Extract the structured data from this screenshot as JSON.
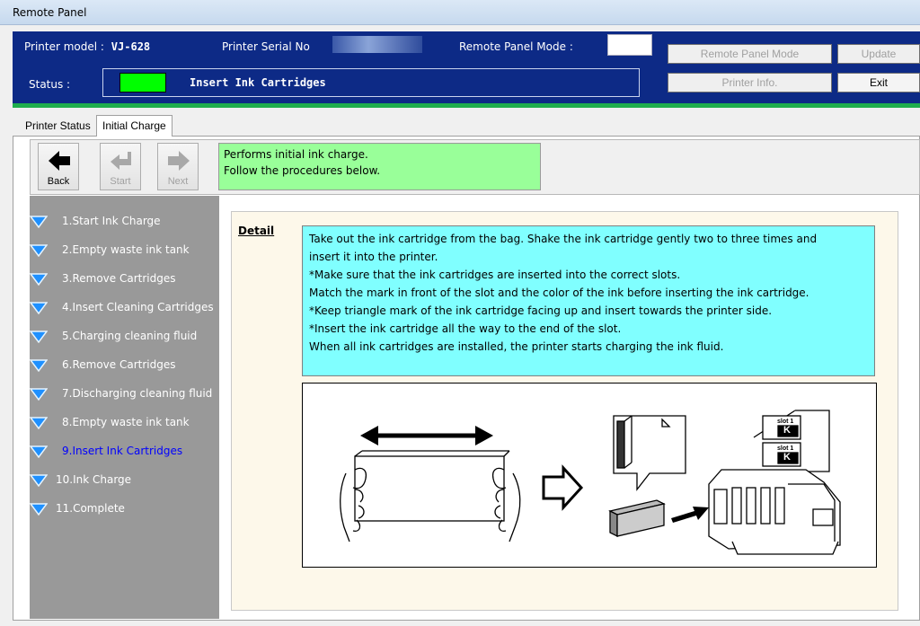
{
  "window": {
    "title": "Remote Panel"
  },
  "header": {
    "model_label": "Printer model :",
    "model_value": "VJ-628",
    "serial_label": "Printer Serial No",
    "mode_label": "Remote Panel Mode :",
    "status_label": "Status :",
    "status_text": "Insert Ink Cartridges",
    "status_color": "#00ff00",
    "buttons": {
      "remote_panel_mode": "Remote Panel Mode",
      "update": "Update",
      "printer_info": "Printer Info.",
      "exit": "Exit"
    }
  },
  "tabs": [
    {
      "label": "Printer Status",
      "active": false
    },
    {
      "label": "Initial Charge",
      "active": true
    }
  ],
  "toolbar": {
    "back_label": "Back",
    "start_label": "Start",
    "next_label": "Next",
    "message_line1": "Performs initial ink charge.",
    "message_line2": "Follow the procedures below."
  },
  "steps": [
    {
      "label": "1.Start Ink Charge"
    },
    {
      "label": "2.Empty waste ink tank"
    },
    {
      "label": "3.Remove Cartridges"
    },
    {
      "label": "4.Insert Cleaning Cartridges"
    },
    {
      "label": "5.Charging cleaning fluid"
    },
    {
      "label": "6.Remove Cartridges"
    },
    {
      "label": "7.Discharging cleaning fluid"
    },
    {
      "label": "8.Empty waste ink tank"
    },
    {
      "label": "9.Insert Ink Cartridges",
      "current": true
    },
    {
      "label": "10.Ink Charge"
    },
    {
      "label": "11.Complete"
    }
  ],
  "detail": {
    "label": "Detail",
    "lines": [
      "Take out the ink cartridge from the bag. Shake the ink cartridge gently two to three times and",
      "insert it into the printer.",
      "*Make sure that the ink cartridges are inserted into the correct slots.",
      " Match the mark in front of the slot and the color of the ink before inserting the ink cartridge.",
      "*Keep triangle mark of the ink cartridge facing up and insert towards the printer side.",
      "*Insert the ink cartridge all the way to the end of the slot.",
      "When all ink cartridges are installed, the printer starts charging the ink fluid."
    ]
  },
  "illustration": {
    "slot_label_1": "slot 1",
    "slot_letter_1": "K",
    "slot_label_2": "slot 1",
    "slot_letter_2": "K"
  },
  "colors": {
    "header_bg": "#0d2a86",
    "accent_green": "#1fae4d",
    "message_bg": "#99ff99",
    "detail_bg": "#80ffff",
    "steps_bg": "#999999",
    "current_step": "#0000ff"
  }
}
